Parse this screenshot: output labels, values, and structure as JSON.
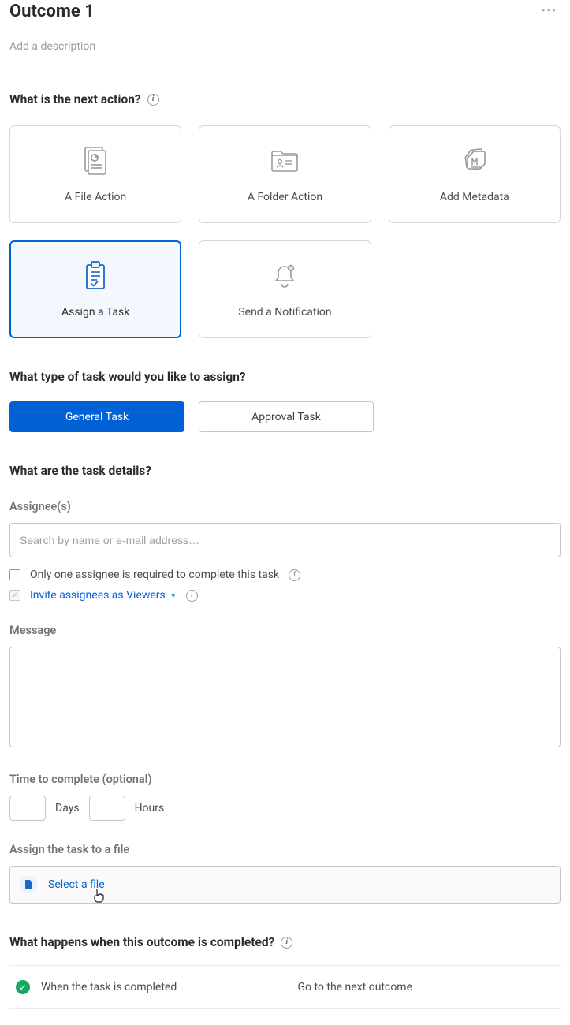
{
  "header": {
    "title": "Outcome 1",
    "description_placeholder": "Add a description"
  },
  "next_action": {
    "heading": "What is the next action?",
    "options": [
      {
        "id": "file-action",
        "label": "A File Action",
        "selected": false
      },
      {
        "id": "folder-action",
        "label": "A Folder Action",
        "selected": false
      },
      {
        "id": "add-metadata",
        "label": "Add Metadata",
        "selected": false
      },
      {
        "id": "assign-task",
        "label": "Assign a Task",
        "selected": true
      },
      {
        "id": "send-notification",
        "label": "Send a Notification",
        "selected": false
      }
    ]
  },
  "task_type": {
    "heading": "What type of task would you like to assign?",
    "general": "General Task",
    "approval": "Approval Task"
  },
  "task_details": {
    "heading": "What are the task details?",
    "assignees_label": "Assignee(s)",
    "assignees_placeholder": "Search by name or e-mail address…",
    "only_one_label": "Only one assignee is required to complete this task",
    "invite_label": "Invite assignees as Viewers",
    "message_label": "Message",
    "time_label": "Time to complete (optional)",
    "days_label": "Days",
    "hours_label": "Hours",
    "assign_file_label": "Assign the task to a file",
    "select_file_label": "Select a file"
  },
  "completion": {
    "heading": "What happens when this outcome is completed?",
    "left": "When the task is completed",
    "right": "Go to the next outcome"
  }
}
